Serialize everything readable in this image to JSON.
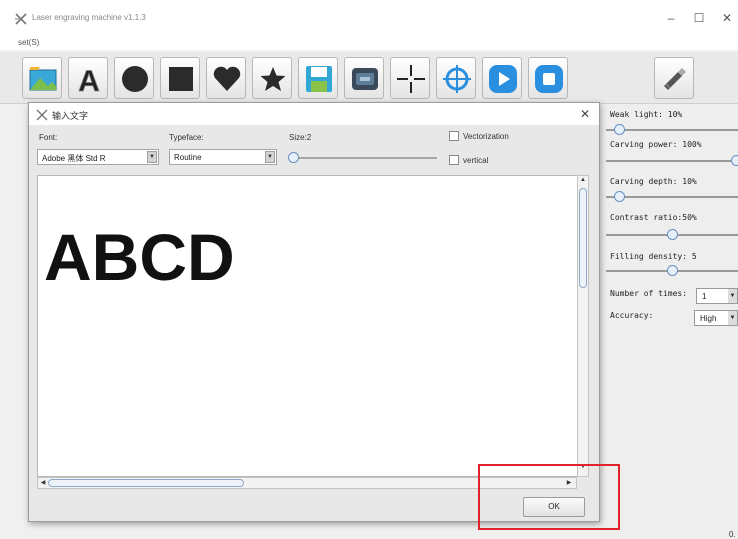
{
  "window": {
    "title": "Laser engraving machine v1.1.3",
    "minimize_glyph": "–",
    "maximize_glyph": "☐",
    "close_glyph": "✕"
  },
  "menu": {
    "set_label": "set(S)"
  },
  "toolbar": {
    "tools": [
      {
        "name": "open-image-icon"
      },
      {
        "name": "text-icon",
        "glyph": "A"
      },
      {
        "name": "circle-icon"
      },
      {
        "name": "square-icon"
      },
      {
        "name": "heart-icon"
      },
      {
        "name": "star-icon"
      },
      {
        "name": "save-icon"
      },
      {
        "name": "engrave-icon"
      },
      {
        "name": "crosshair-icon"
      },
      {
        "name": "target-icon"
      },
      {
        "name": "play-icon"
      },
      {
        "name": "stop-icon"
      },
      {
        "name": "usb-icon"
      }
    ],
    "accent_blue": "#2b8fe0"
  },
  "dialog": {
    "title": "输入文字",
    "close_glyph": "✕",
    "font_label": "Font:",
    "font_value": "Adobe 黑体 Std R",
    "typeface_label": "Typeface:",
    "typeface_value": "Routine",
    "size_label": "Size:2",
    "vectorization_label": "Vectorization",
    "vectorization_checked": false,
    "vertical_label": "vertical",
    "vertical_checked": false,
    "text_content": "ABCD",
    "ok_label": "OK"
  },
  "settings": {
    "weak_light": "Weak light: 10%",
    "carving_power": "Carving power: 100%",
    "carving_depth": "Carving depth: 10%",
    "contrast_ratio": "Contrast ratio:50%",
    "filling_density": "Filling density: 5",
    "number_of_times_label": "Number of times:",
    "number_of_times_value": "1",
    "accuracy_label": "Accuracy:",
    "accuracy_value": "High",
    "corner_text": "0."
  },
  "highlight_color": "#e0242a"
}
